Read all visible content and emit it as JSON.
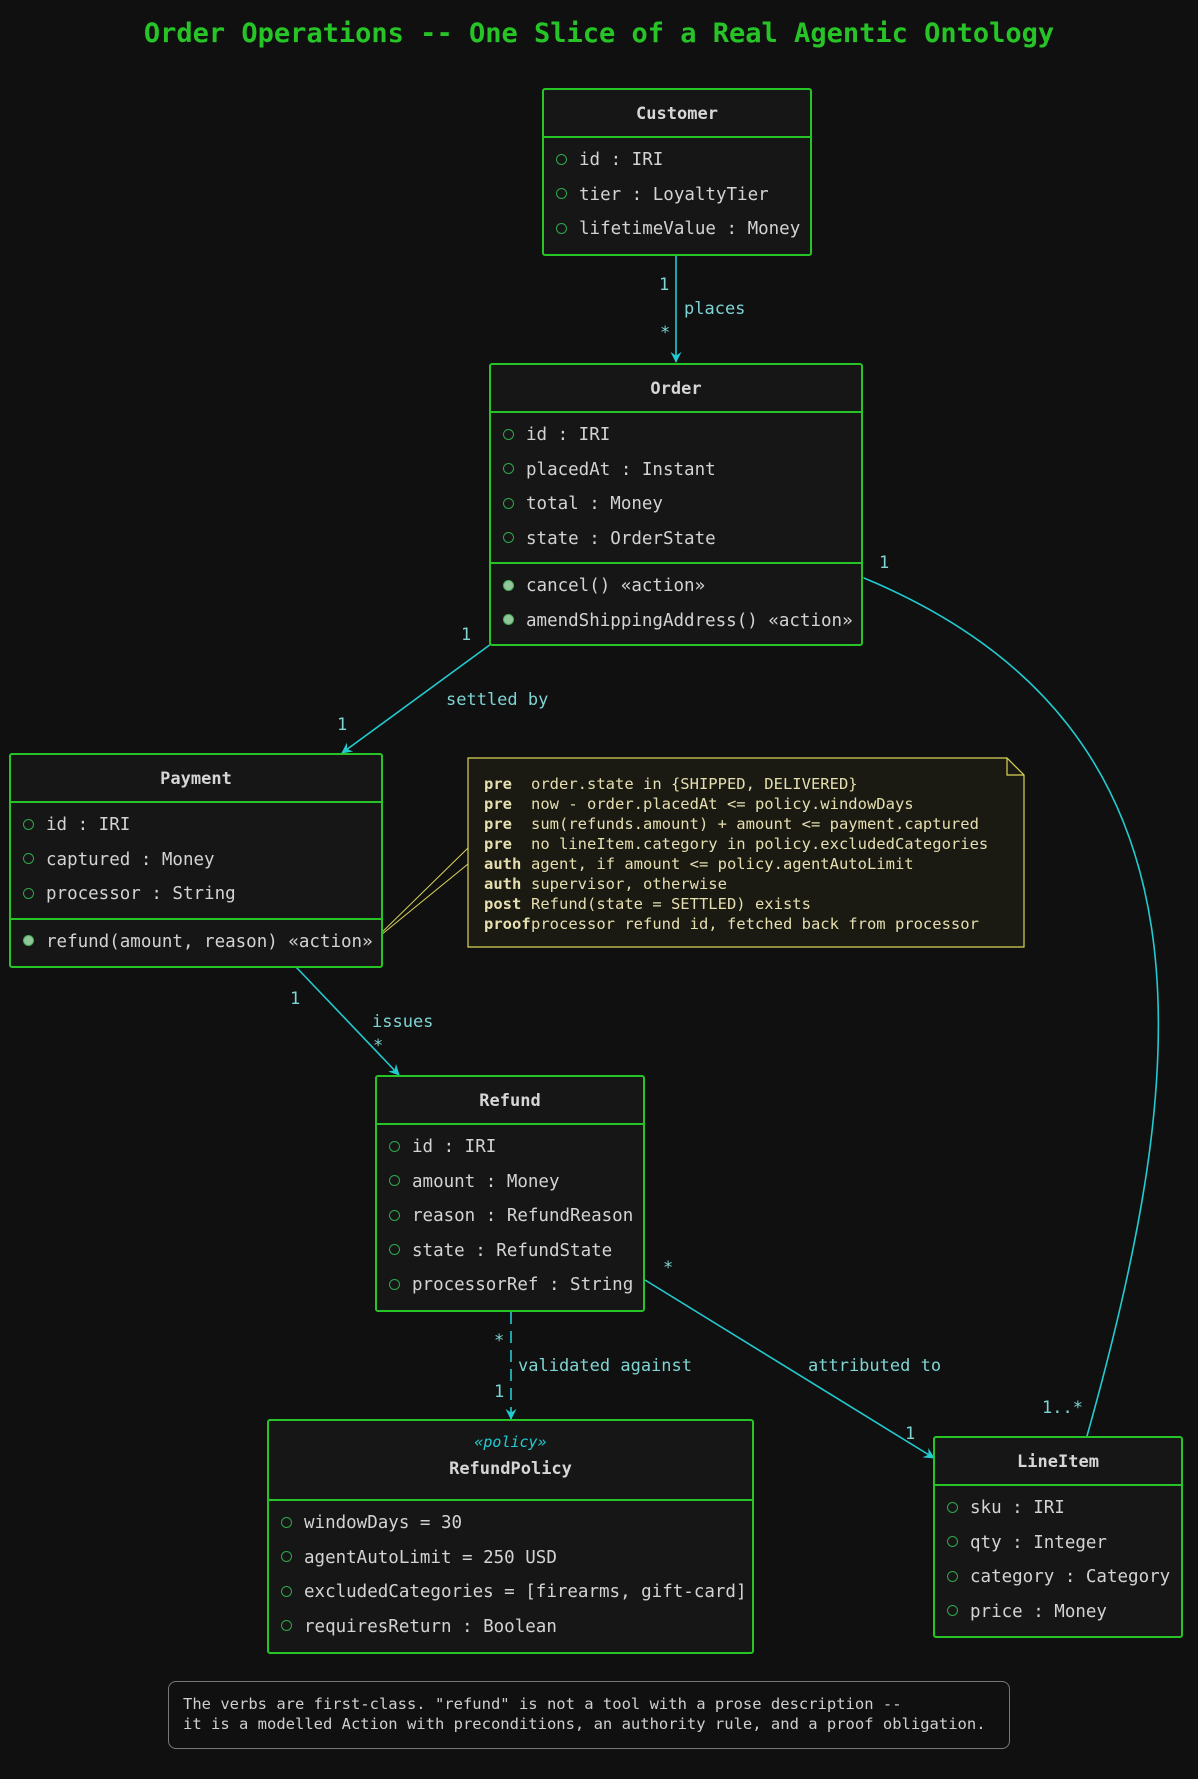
{
  "title": "Order Operations -- One Slice of a Real Agentic Ontology",
  "classes": {
    "customer": {
      "name": "Customer",
      "attributes": [
        "id : IRI",
        "tier : LoyaltyTier",
        "lifetimeValue : Money"
      ]
    },
    "order": {
      "name": "Order",
      "attributes": [
        "id : IRI",
        "placedAt : Instant",
        "total : Money",
        "state : OrderState"
      ],
      "operations": [
        "cancel() «action»",
        "amendShippingAddress() «action»"
      ]
    },
    "payment": {
      "name": "Payment",
      "attributes": [
        "id : IRI",
        "captured : Money",
        "processor : String"
      ],
      "operations": [
        "refund(amount, reason) «action»"
      ]
    },
    "refund": {
      "name": "Refund",
      "attributes": [
        "id : IRI",
        "amount : Money",
        "reason : RefundReason",
        "state : RefundState",
        "processorRef : String"
      ]
    },
    "refund_policy": {
      "stereotype": "«policy»",
      "name": "RefundPolicy",
      "attributes": [
        "windowDays = 30",
        "agentAutoLimit = 250 USD",
        "excludedCategories = [firearms, gift-card]",
        "requiresReturn : Boolean"
      ]
    },
    "line_item": {
      "name": "LineItem",
      "attributes": [
        "sku : IRI",
        "qty : Integer",
        "category : Category",
        "price : Money"
      ]
    }
  },
  "relations": {
    "places": {
      "label": "places",
      "source_mult": "1",
      "target_mult": "*"
    },
    "settled_by": {
      "label": "settled by",
      "source_mult": "1",
      "target_mult": "1"
    },
    "issues": {
      "label": "issues",
      "source_mult": "1",
      "target_mult": "*"
    },
    "validated_against": {
      "label": "validated against",
      "source_mult": "*",
      "target_mult": "1"
    },
    "attributed_to": {
      "label": "attributed to",
      "source_mult": "*",
      "target_mult": "1"
    },
    "composition": {
      "order_mult": "1",
      "lineitem_mult": "1..*"
    }
  },
  "note": {
    "lines": [
      {
        "kw": "pre",
        "text": "order.state in {SHIPPED, DELIVERED}"
      },
      {
        "kw": "pre",
        "text": "now - order.placedAt <= policy.windowDays"
      },
      {
        "kw": "pre",
        "text": "sum(refunds.amount) + amount <= payment.captured"
      },
      {
        "kw": "pre",
        "text": "no lineItem.category in policy.excludedCategories"
      },
      {
        "kw": "auth",
        "text": "agent, if amount <= policy.agentAutoLimit"
      },
      {
        "kw": "auth",
        "text": "supervisor, otherwise"
      },
      {
        "kw": "post",
        "text": "Refund(state = SETTLED) exists"
      },
      {
        "kw": "proof",
        "text": "processor refund id, fetched back from processor"
      }
    ]
  },
  "caption": {
    "line1": "The verbs are first-class. \"refund\" is not a tool with a prose description --",
    "line2": "it is a modelled Action with preconditions, an authority rule, and a proof obligation."
  },
  "colors": {
    "background": "#101010",
    "class_border": "#27c427",
    "title": "#27c427",
    "edge": "#22cbd0",
    "note_border": "#d9d35a",
    "note_bg": "#1b1a12"
  }
}
